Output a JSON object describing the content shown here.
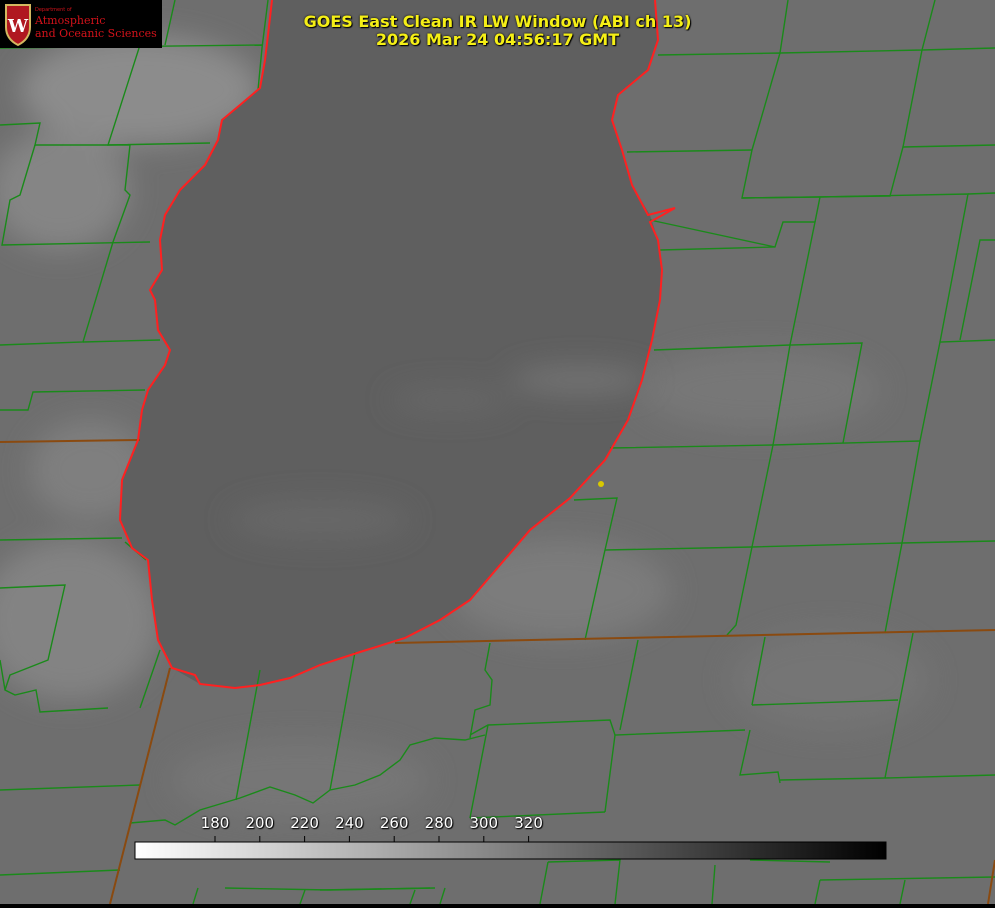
{
  "title": {
    "line1": "GOES East Clean IR LW Window (ABI ch 13)",
    "line2": "2026 Mar 24 04:56:17 GMT"
  },
  "logo": {
    "small_text": "Department of",
    "line1": "Atmospheric",
    "line2": "and Oceanic Sciences",
    "crest_letter": "W"
  },
  "colorbar": {
    "ticks": [
      "180",
      "200",
      "220",
      "240",
      "260",
      "280",
      "300",
      "320"
    ]
  },
  "colors": {
    "shoreline": "#ff2020",
    "county_lines": "#1a8a1a",
    "state_lines": "#8a4a10",
    "title_text": "#f5ef16",
    "marker": "#d8c800"
  }
}
